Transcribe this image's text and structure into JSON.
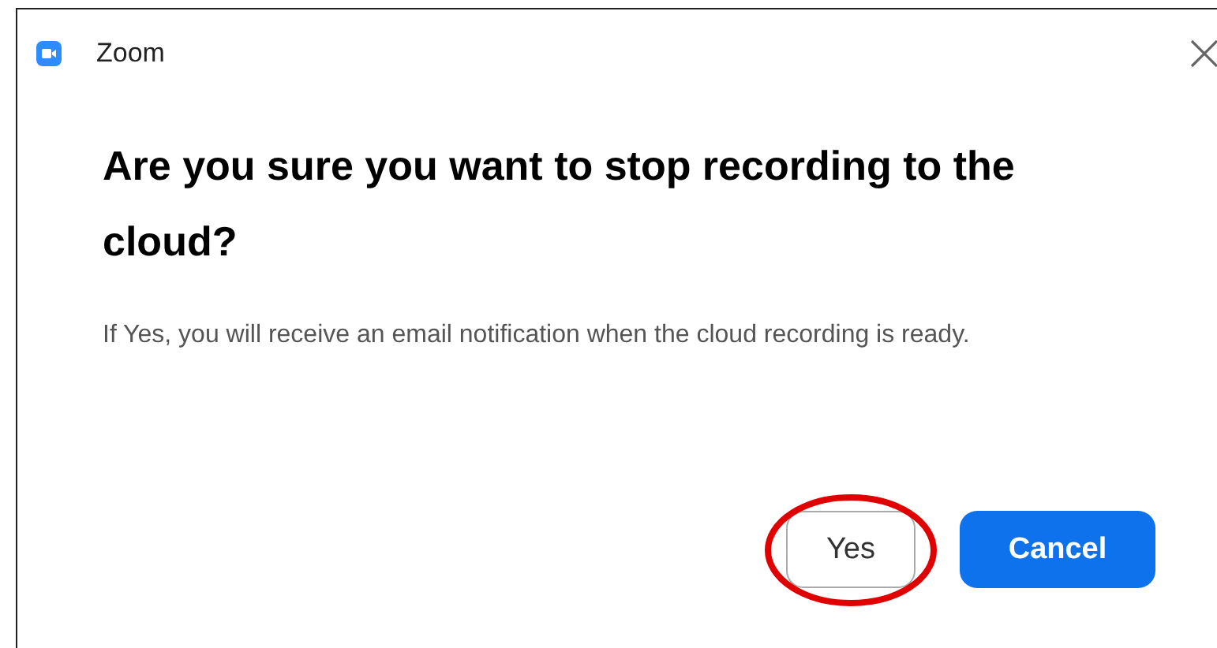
{
  "window": {
    "title": "Zoom"
  },
  "dialog": {
    "heading": "Are you sure you want to stop recording to the cloud?",
    "message": "If Yes, you will receive an email notification when the cloud recording is ready."
  },
  "buttons": [
    {
      "label": "Yes",
      "kind": "secondary",
      "highlighted": true
    },
    {
      "label": "Cancel",
      "kind": "primary",
      "highlighted": false
    }
  ]
}
